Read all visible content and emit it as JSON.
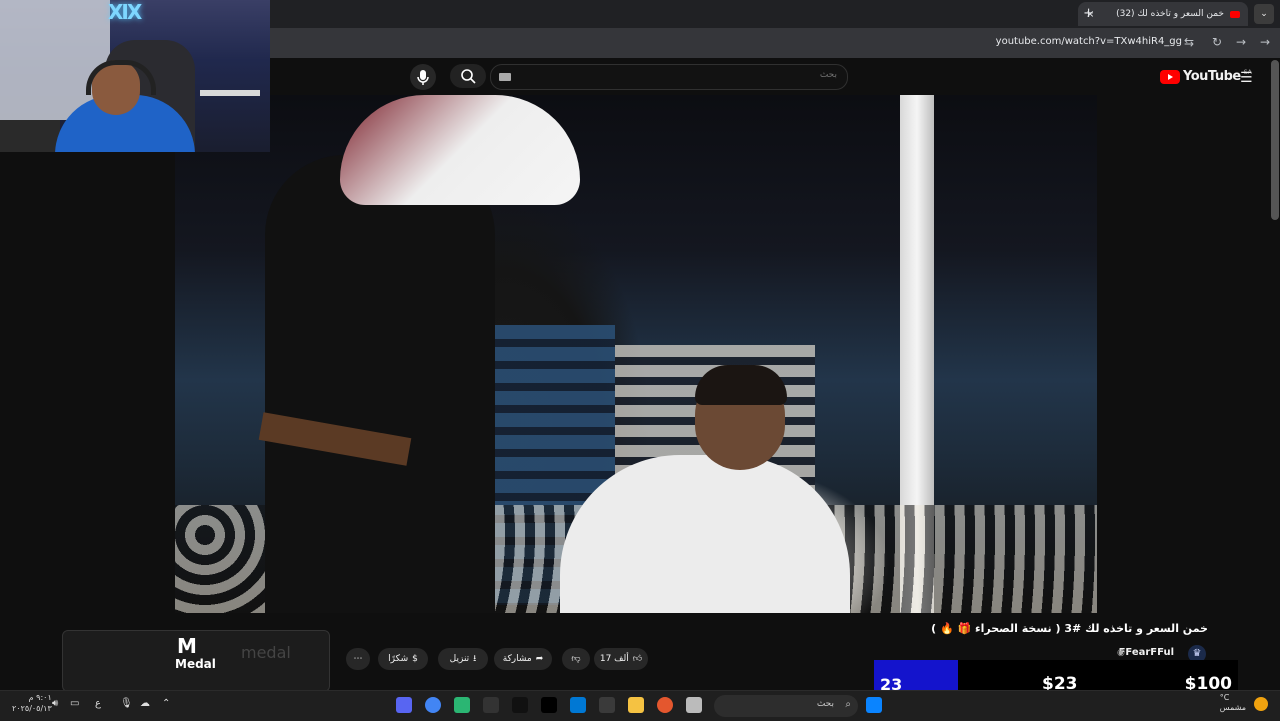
{
  "browser": {
    "tab_title": "(32) خمن السعر و تاخذه لك",
    "new_tab": "+",
    "tab_close": "×",
    "url": "youtube.com/watch?v=TXw4hiR4_gg"
  },
  "youtube": {
    "search_placeholder": "بحث",
    "logo_text": "YouTube",
    "logo_country": "SA",
    "video_title": "خمن السعر و تاخذه لك #3 ( نسخة الصحراء 🎁 🔥 )",
    "channel_name": "FFearFFul",
    "actions": {
      "like_count": "17 ألف",
      "share": "مشاركة",
      "download": "تنزيل",
      "thanks": "شكرًا",
      "more": "⋯"
    }
  },
  "webcam": {
    "logo": "XIX"
  },
  "medal": {
    "title": "Medal",
    "watermark": "medal"
  },
  "donation": {
    "counter": "23",
    "amount_current": "$23",
    "amount_goal": "$100"
  },
  "taskbar": {
    "search_text": "بحث",
    "lang": "ع",
    "time": "٩:٠١ م",
    "date": "٢٠٢٥/٠٥/١٣",
    "weather_temp": "°C",
    "weather_text": "مشمس"
  }
}
